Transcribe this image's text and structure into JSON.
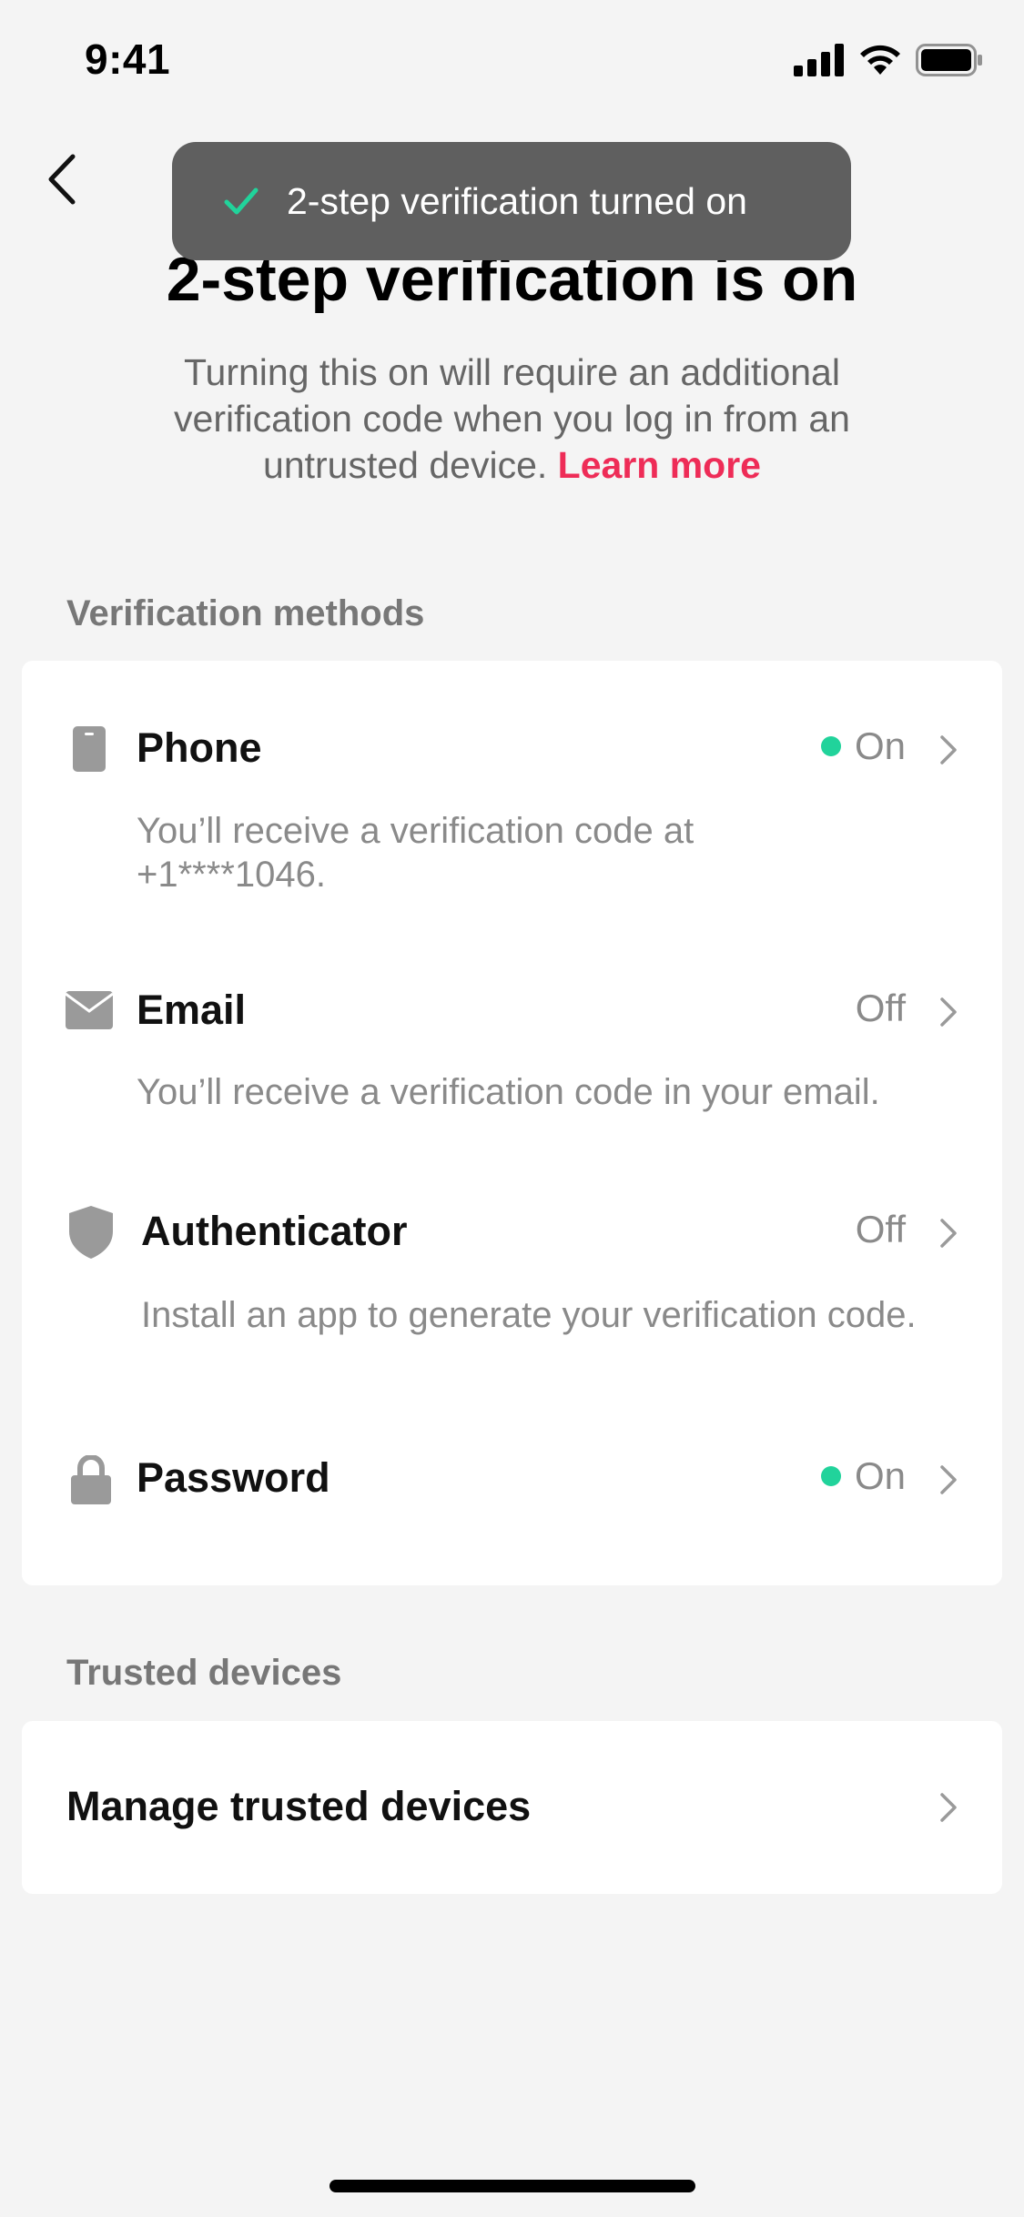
{
  "status_bar": {
    "time": "9:41"
  },
  "toast": {
    "text": "2-step verification turned on"
  },
  "header": {
    "title": "2-step verification is on",
    "subtitle": "Turning this on will require an additional verification code when you log in from an untrusted device.",
    "learn_more": "Learn more"
  },
  "verification": {
    "section_label": "Verification methods",
    "methods": [
      {
        "title": "Phone",
        "status": "On",
        "desc": "You’ll receive a verification code at +1****1046."
      },
      {
        "title": "Email",
        "status": "Off",
        "desc": "You’ll receive a verification code in your email."
      },
      {
        "title": "Authenticator",
        "status": "Off",
        "desc": "Install an app to generate your verification code."
      },
      {
        "title": "Password",
        "status": "On"
      }
    ]
  },
  "trusted": {
    "section_label": "Trusted devices",
    "manage_label": "Manage trusted devices"
  },
  "colors": {
    "accent": "#ee2c57",
    "status_on": "#21d39b",
    "toast_bg": "#5f5f5f"
  }
}
